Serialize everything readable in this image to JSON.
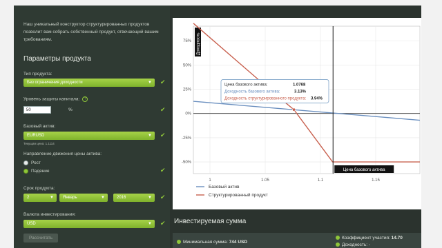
{
  "sidebar": {
    "intro": "Наш уникальный конструктор структурированных продуктов позволит вам собрать собственный продукт, отвечающий вашим требованиям.",
    "title": "Параметры продукта",
    "product_type_label": "Тип продукта:",
    "product_type_value": "Без ограничения доходности",
    "protection_label": "Уровень защиты капитала:",
    "protection_value": "50",
    "protection_unit": "%",
    "asset_label": "Базовый актив:",
    "asset_value": "EURUSD",
    "current_price": "Текущая цена: 1.1114",
    "direction_label": "Направление движения цены актива:",
    "direction_options": [
      "Рост",
      "Падение"
    ],
    "direction_selected": "Падение",
    "term_label": "Срок продукта:",
    "term_num": "2",
    "term_month": "Январь",
    "term_year": "2016",
    "currency_label": "Валюта инвестирования:",
    "currency_value": "USD",
    "calc_button": "Рассчитать"
  },
  "chart_data": {
    "type": "line",
    "x_ticks": [
      "1",
      "1.05",
      "1.1",
      "1.15"
    ],
    "y_ticks": [
      "75%",
      "50%",
      "25%",
      "0%",
      "-25%",
      "-50%"
    ],
    "xlim": [
      0.985,
      1.19
    ],
    "ylim": [
      -0.62,
      0.9
    ],
    "ylabel": "Доходность",
    "marker_x": 1.1114,
    "marker_label": "Цена базового актива",
    "series": [
      {
        "name": "Базовый актив",
        "color": "#6a8fbf",
        "points": [
          [
            0.985,
            0.125
          ],
          [
            1.19,
            -0.07
          ]
        ]
      },
      {
        "name": "Структурированный продукт",
        "color": "#c8604e",
        "points": [
          [
            0.985,
            0.93
          ],
          [
            1.06,
            0.19
          ],
          [
            1.076,
            0.0394
          ],
          [
            1.111,
            -0.5
          ],
          [
            1.19,
            -0.5
          ]
        ]
      }
    ],
    "tooltip": {
      "price_label": "Цена базового актива:",
      "price": "1.0768",
      "asset_label": "Доходность базового актива:",
      "asset_value": "3.13%",
      "product_label": "Доходность структурированного продукта:",
      "product_value": "3.94%"
    }
  },
  "investment": {
    "title": "Инвестируемая сумма",
    "min_sum_label": "Минимальная сумма:",
    "min_sum_value": "744 USD",
    "coef_label": "Коэффициент участия:",
    "coef_value": "14.70",
    "yield_label": "Доходность:",
    "yield_value": "-"
  }
}
